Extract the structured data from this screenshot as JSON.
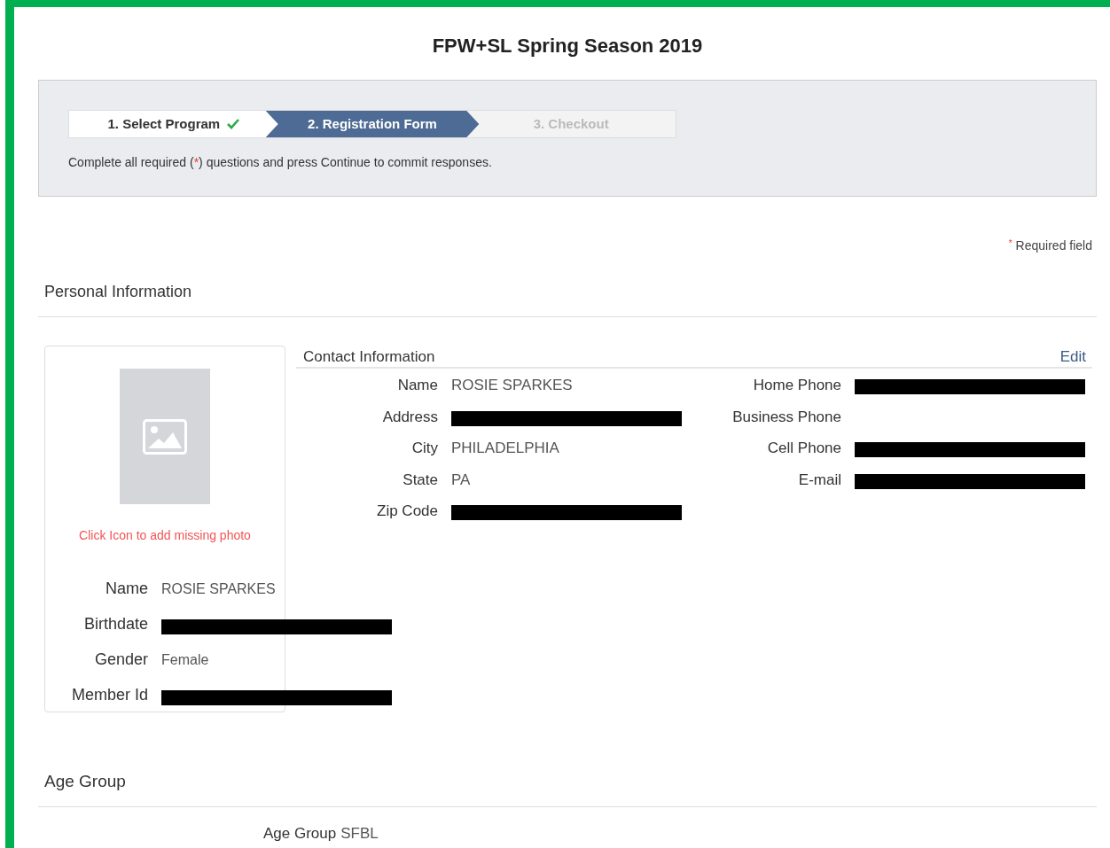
{
  "title": "FPW+SL Spring Season 2019",
  "steps": [
    {
      "label": "1. Select Program",
      "selected": false,
      "completed": true
    },
    {
      "label": "2. Registration Form",
      "selected": true,
      "completed": false
    },
    {
      "label": "3. Checkout",
      "selected": false,
      "completed": false
    }
  ],
  "instructions": {
    "before": "Complete all required (",
    "mark": "*",
    "after": ") questions and press Continue to commit responses."
  },
  "required_note": {
    "mark": "*",
    "text": "Required field"
  },
  "personal_section": {
    "heading": "Personal Information"
  },
  "photo_hint": "Click Icon to add missing photo",
  "profile_fields": [
    {
      "label": "Name",
      "kind": "text",
      "value": "ROSIE SPARKES"
    },
    {
      "label": "Birthdate",
      "kind": "redacted"
    },
    {
      "label": "Gender",
      "kind": "text",
      "value": "Female"
    },
    {
      "label": "Member Id",
      "kind": "redacted"
    }
  ],
  "contact": {
    "heading": "Contact Information",
    "edit_link": "Edit",
    "left_fields": [
      {
        "label": "Name",
        "kind": "text",
        "value": "ROSIE SPARKES"
      },
      {
        "label": "Address",
        "kind": "redacted"
      },
      {
        "label": "City",
        "kind": "text",
        "value": "PHILADELPHIA"
      },
      {
        "label": "State",
        "kind": "text",
        "value": "PA"
      },
      {
        "label": "Zip Code",
        "kind": "redacted"
      }
    ],
    "right_fields": [
      {
        "label": "Home Phone",
        "kind": "redacted"
      },
      {
        "label": "Business Phone",
        "kind": "empty"
      },
      {
        "label": "Cell Phone",
        "kind": "redacted"
      },
      {
        "label": "E-mail",
        "kind": "redacted"
      }
    ]
  },
  "age_section": {
    "heading": "Age Group",
    "label": "Age Group",
    "value": "SFBL"
  }
}
